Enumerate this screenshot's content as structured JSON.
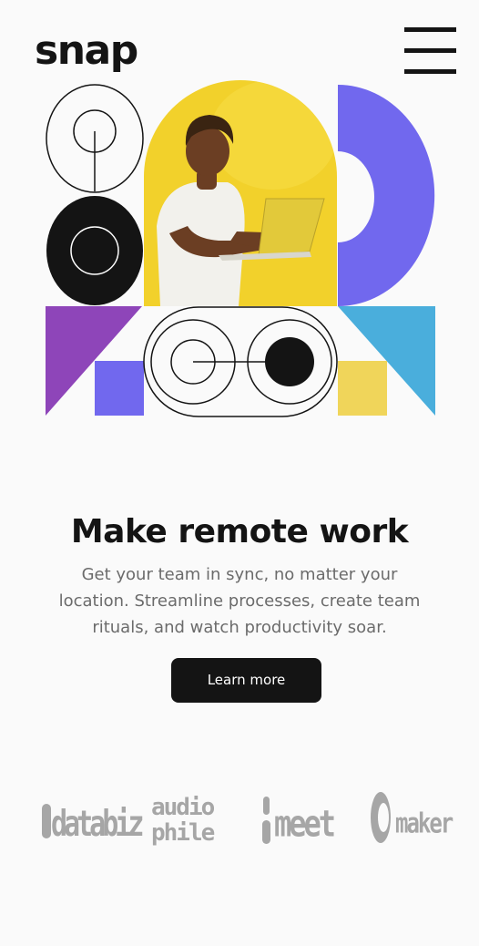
{
  "header": {
    "logo": "snap",
    "menu_icon": "hamburger-menu-icon"
  },
  "hero": {
    "image_alt": "person holding a laptop",
    "colors": {
      "yellow": "#f2d12b",
      "purple": "#7168ee",
      "violet": "#8e45b9",
      "cyan": "#4aaedc",
      "soft_yellow": "#f0d55a",
      "ink": "#141414"
    }
  },
  "main": {
    "headline": "Make remote work",
    "description": "Get your team in sync, no matter your location. Streamline processes, create team rituals, and watch productivity soar.",
    "cta_label": "Learn more"
  },
  "clients": [
    {
      "name": "databiz",
      "text": "databiz"
    },
    {
      "name": "audiophile",
      "text": "audio\nphile"
    },
    {
      "name": "meet",
      "text": "meet"
    },
    {
      "name": "maker",
      "text": "maker"
    }
  ]
}
